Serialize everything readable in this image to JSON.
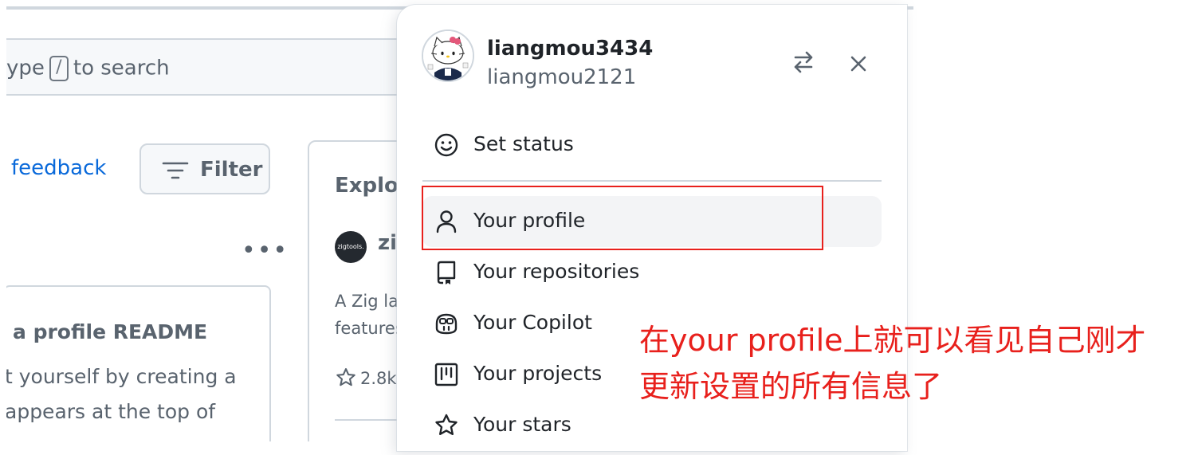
{
  "search": {
    "text_before": "ype",
    "slash_key": "/",
    "text_after": "to search"
  },
  "feed": {
    "feedback_link": "feedback",
    "filter_label": "Filter",
    "more_icon": "kebab-horizontal-icon",
    "readme_card": {
      "title": "a profile README",
      "lines": [
        "t yourself by creating a",
        "appears at the top of"
      ]
    }
  },
  "explore": {
    "title": "Explore",
    "repo_logo_text": "zigtools.",
    "repo_name": "zig",
    "desc_lines": [
      "A Zig lar",
      "features"
    ],
    "stars": "2.8k"
  },
  "dropdown": {
    "username": "liangmou3434",
    "handle": "liangmou2121",
    "switch_icon": "arrow-switch-icon",
    "close_icon": "x-icon",
    "items": [
      {
        "label": "Set status",
        "icon": "smiley-icon"
      },
      {
        "label": "Your profile",
        "icon": "person-icon"
      },
      {
        "label": "Your repositories",
        "icon": "repo-icon"
      },
      {
        "label": "Your Copilot",
        "icon": "copilot-icon"
      },
      {
        "label": "Your projects",
        "icon": "project-icon"
      },
      {
        "label": "Your stars",
        "icon": "star-icon"
      }
    ]
  },
  "annotation": {
    "text": "在your profile上就可以看见自己刚才更新设置的所有信息了",
    "color": "#e8201c"
  },
  "colors": {
    "link": "#0969da",
    "text": "#1f2328",
    "muted": "#59636e",
    "border": "#d0d7de",
    "highlight": "#e8201c"
  }
}
